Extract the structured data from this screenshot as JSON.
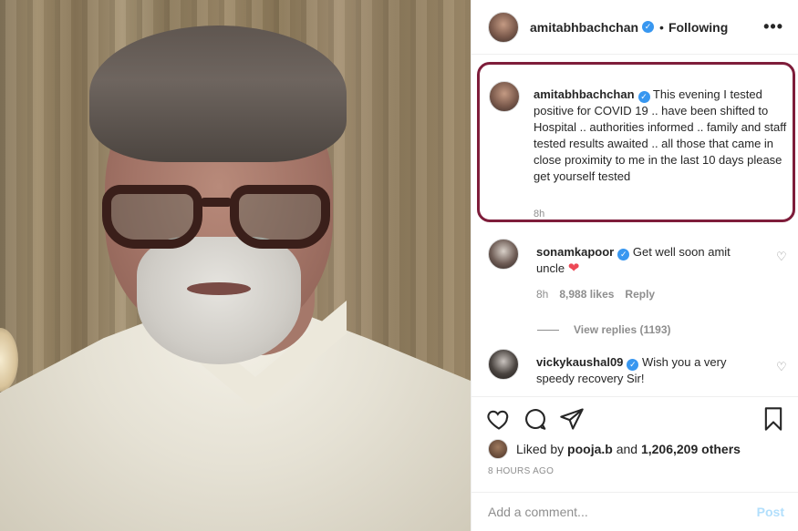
{
  "header": {
    "username": "amitabhbachchan",
    "verified_symbol": "✓",
    "separator": "•",
    "follow_status": "Following",
    "more_symbol": "•••"
  },
  "caption": {
    "username": "amitabhbachchan",
    "text": " This evening I tested positive for COVID 19 .. have been shifted to Hospital .. authorities informed .. family and staff tested results awaited .. all those that came in close proximity to me in the last 10 days please get yourself tested",
    "time": "8h",
    "highlight_color": "#7e1d3a"
  },
  "comments": [
    {
      "username": "sonamkapoor",
      "text": " Get well soon amit uncle ",
      "emoji": "❤",
      "time": "8h",
      "likes": "8,988 likes",
      "reply": "Reply",
      "view_replies": "View replies (1193)"
    },
    {
      "username": "vickykaushal09",
      "text": " Wish you a very speedy recovery Sir!"
    }
  ],
  "actions": {
    "like_icon": "heart-icon",
    "comment_icon": "comment-icon",
    "share_icon": "share-icon",
    "save_icon": "bookmark-icon"
  },
  "likes": {
    "prefix": "Liked by ",
    "user": "pooja.b",
    "middle": " and ",
    "count": "1,206,209 others"
  },
  "time_ago": "8 HOURS AGO",
  "comment_box": {
    "placeholder": "Add a comment...",
    "post_label": "Post"
  },
  "colors": {
    "verified": "#3897f0",
    "heart_red": "#ed4956",
    "post_disabled": "#b2dffc"
  }
}
